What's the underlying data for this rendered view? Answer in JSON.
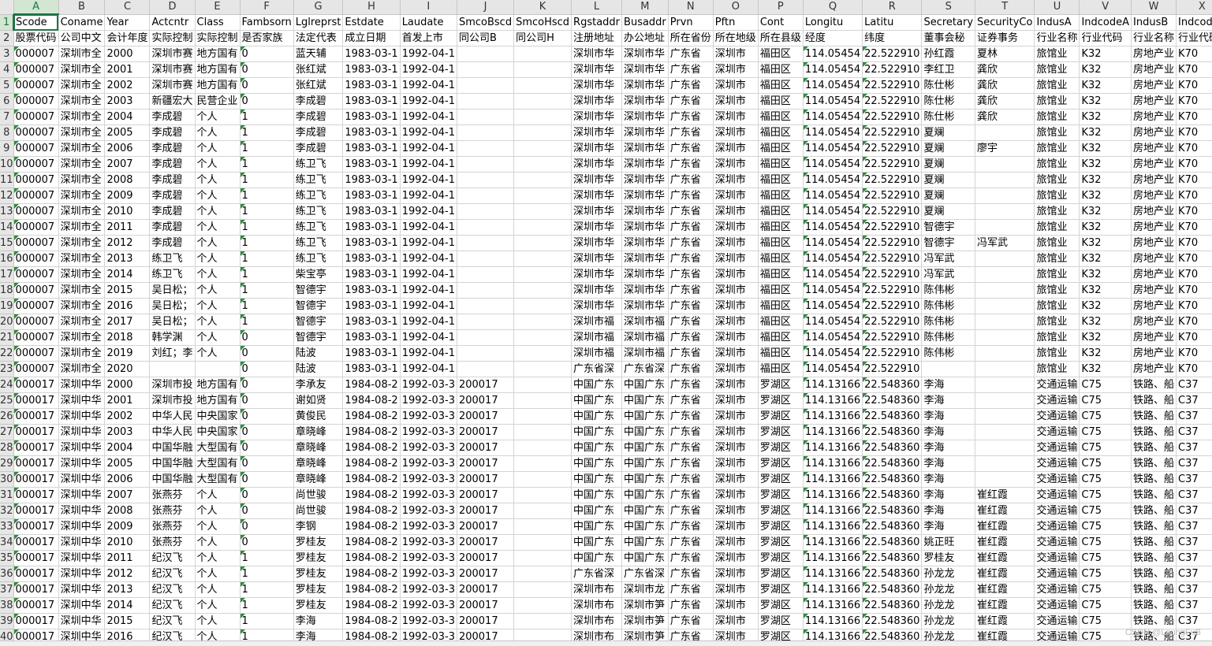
{
  "columns": [
    "A",
    "B",
    "C",
    "D",
    "E",
    "F",
    "G",
    "H",
    "I",
    "J",
    "K",
    "L",
    "M",
    "N",
    "O",
    "P",
    "Q",
    "R",
    "S",
    "T",
    "U",
    "V",
    "W",
    "X"
  ],
  "active_cell": {
    "col": "A",
    "row": 1
  },
  "rows": [
    {
      "n": "1",
      "c": [
        "Scode",
        "Coname",
        "Year",
        "Actcntr",
        "Class",
        "Fambsorn",
        "Lglreprst",
        "Estdate",
        "Laudate",
        "SmcoBscd",
        "SmcoHscd",
        "Rgstaddr",
        "Busaddr",
        "Prvn",
        "Pftn",
        "Cont",
        "Longitu",
        "Latitu",
        "Secretary",
        "SecurityCo",
        "IndusA",
        "IndcodeA",
        "IndusB",
        "IndcodeB"
      ]
    },
    {
      "n": "2",
      "c": [
        "股票代码",
        "公司中文",
        "会计年度",
        "实际控制",
        "实际控制",
        "是否家族",
        "法定代表",
        "成立日期",
        "首发上市",
        "同公司B",
        "同公司H",
        "注册地址",
        "办公地址",
        "所在省份",
        "所在地级",
        "所在县级",
        "经度",
        "纬度",
        "董事会秘",
        "证券事务",
        "行业名称",
        "行业代码",
        "行业名称",
        "行业代码"
      ]
    },
    {
      "n": "3",
      "c": [
        "000007",
        "深圳市全",
        "2000",
        "深圳市赛",
        "地方国有",
        "0",
        "蓝天辅",
        "1983-03-1",
        "1992-04-1",
        "",
        "",
        "深圳市华",
        "深圳市华",
        "广东省",
        "深圳市",
        "福田区",
        "114.05454",
        "22.522910",
        "孙红霞",
        "夏林",
        "旅馆业",
        "K32",
        "房地产业",
        "K70"
      ]
    },
    {
      "n": "4",
      "c": [
        "000007",
        "深圳市全",
        "2001",
        "深圳市赛",
        "地方国有",
        "0",
        "张红斌",
        "1983-03-1",
        "1992-04-1",
        "",
        "",
        "深圳市华",
        "深圳市华",
        "广东省",
        "深圳市",
        "福田区",
        "114.05454",
        "22.522910",
        "李红卫",
        "龚欣",
        "旅馆业",
        "K32",
        "房地产业",
        "K70"
      ]
    },
    {
      "n": "5",
      "c": [
        "000007",
        "深圳市全",
        "2002",
        "深圳市赛",
        "地方国有",
        "0",
        "张红斌",
        "1983-03-1",
        "1992-04-1",
        "",
        "",
        "深圳市华",
        "深圳市华",
        "广东省",
        "深圳市",
        "福田区",
        "114.05454",
        "22.522910",
        "陈仕彬",
        "龚欣",
        "旅馆业",
        "K32",
        "房地产业",
        "K70"
      ]
    },
    {
      "n": "6",
      "c": [
        "000007",
        "深圳市全",
        "2003",
        "新疆宏大",
        "民营企业",
        "0",
        "李成碧",
        "1983-03-1",
        "1992-04-1",
        "",
        "",
        "深圳市华",
        "深圳市华",
        "广东省",
        "深圳市",
        "福田区",
        "114.05454",
        "22.522910",
        "陈仕彬",
        "龚欣",
        "旅馆业",
        "K32",
        "房地产业",
        "K70"
      ]
    },
    {
      "n": "7",
      "c": [
        "000007",
        "深圳市全",
        "2004",
        "李成碧",
        "个人",
        "1",
        "李成碧",
        "1983-03-1",
        "1992-04-1",
        "",
        "",
        "深圳市华",
        "深圳市华",
        "广东省",
        "深圳市",
        "福田区",
        "114.05454",
        "22.522910",
        "陈仕彬",
        "龚欣",
        "旅馆业",
        "K32",
        "房地产业",
        "K70"
      ]
    },
    {
      "n": "8",
      "c": [
        "000007",
        "深圳市全",
        "2005",
        "李成碧",
        "个人",
        "1",
        "李成碧",
        "1983-03-1",
        "1992-04-1",
        "",
        "",
        "深圳市华",
        "深圳市华",
        "广东省",
        "深圳市",
        "福田区",
        "114.05454",
        "22.522910",
        "夏斓",
        "",
        "旅馆业",
        "K32",
        "房地产业",
        "K70"
      ]
    },
    {
      "n": "9",
      "c": [
        "000007",
        "深圳市全",
        "2006",
        "李成碧",
        "个人",
        "1",
        "李成碧",
        "1983-03-1",
        "1992-04-1",
        "",
        "",
        "深圳市华",
        "深圳市华",
        "广东省",
        "深圳市",
        "福田区",
        "114.05454",
        "22.522910",
        "夏斓",
        "廖宇",
        "旅馆业",
        "K32",
        "房地产业",
        "K70"
      ]
    },
    {
      "n": "10",
      "c": [
        "000007",
        "深圳市全",
        "2007",
        "李成碧",
        "个人",
        "1",
        "练卫飞",
        "1983-03-1",
        "1992-04-1",
        "",
        "",
        "深圳市华",
        "深圳市华",
        "广东省",
        "深圳市",
        "福田区",
        "114.05454",
        "22.522910",
        "夏斓",
        "",
        "旅馆业",
        "K32",
        "房地产业",
        "K70"
      ]
    },
    {
      "n": "11",
      "c": [
        "000007",
        "深圳市全",
        "2008",
        "李成碧",
        "个人",
        "1",
        "练卫飞",
        "1983-03-1",
        "1992-04-1",
        "",
        "",
        "深圳市华",
        "深圳市华",
        "广东省",
        "深圳市",
        "福田区",
        "114.05454",
        "22.522910",
        "夏斓",
        "",
        "旅馆业",
        "K32",
        "房地产业",
        "K70"
      ]
    },
    {
      "n": "12",
      "c": [
        "000007",
        "深圳市全",
        "2009",
        "李成碧",
        "个人",
        "1",
        "练卫飞",
        "1983-03-1",
        "1992-04-1",
        "",
        "",
        "深圳市华",
        "深圳市华",
        "广东省",
        "深圳市",
        "福田区",
        "114.05454",
        "22.522910",
        "夏斓",
        "",
        "旅馆业",
        "K32",
        "房地产业",
        "K70"
      ]
    },
    {
      "n": "13",
      "c": [
        "000007",
        "深圳市全",
        "2010",
        "李成碧",
        "个人",
        "1",
        "练卫飞",
        "1983-03-1",
        "1992-04-1",
        "",
        "",
        "深圳市华",
        "深圳市华",
        "广东省",
        "深圳市",
        "福田区",
        "114.05454",
        "22.522910",
        "夏斓",
        "",
        "旅馆业",
        "K32",
        "房地产业",
        "K70"
      ]
    },
    {
      "n": "14",
      "c": [
        "000007",
        "深圳市全",
        "2011",
        "李成碧",
        "个人",
        "1",
        "练卫飞",
        "1983-03-1",
        "1992-04-1",
        "",
        "",
        "深圳市华",
        "深圳市华",
        "广东省",
        "深圳市",
        "福田区",
        "114.05454",
        "22.522910",
        "智德宇",
        "",
        "旅馆业",
        "K32",
        "房地产业",
        "K70"
      ]
    },
    {
      "n": "15",
      "c": [
        "000007",
        "深圳市全",
        "2012",
        "李成碧",
        "个人",
        "1",
        "练卫飞",
        "1983-03-1",
        "1992-04-1",
        "",
        "",
        "深圳市华",
        "深圳市华",
        "广东省",
        "深圳市",
        "福田区",
        "114.05454",
        "22.522910",
        "智德宇",
        "冯军武",
        "旅馆业",
        "K32",
        "房地产业",
        "K70"
      ]
    },
    {
      "n": "16",
      "c": [
        "000007",
        "深圳市全",
        "2013",
        "练卫飞",
        "个人",
        "1",
        "练卫飞",
        "1983-03-1",
        "1992-04-1",
        "",
        "",
        "深圳市华",
        "深圳市华",
        "广东省",
        "深圳市",
        "福田区",
        "114.05454",
        "22.522910",
        "冯军武",
        "",
        "旅馆业",
        "K32",
        "房地产业",
        "K70"
      ]
    },
    {
      "n": "17",
      "c": [
        "000007",
        "深圳市全",
        "2014",
        "练卫飞",
        "个人",
        "1",
        "柴宝亭",
        "1983-03-1",
        "1992-04-1",
        "",
        "",
        "深圳市华",
        "深圳市华",
        "广东省",
        "深圳市",
        "福田区",
        "114.05454",
        "22.522910",
        "冯军武",
        "",
        "旅馆业",
        "K32",
        "房地产业",
        "K70"
      ]
    },
    {
      "n": "18",
      "c": [
        "000007",
        "深圳市全",
        "2015",
        "吴日松；",
        "个人",
        "1",
        "智德宇",
        "1983-03-1",
        "1992-04-1",
        "",
        "",
        "深圳市华",
        "深圳市华",
        "广东省",
        "深圳市",
        "福田区",
        "114.05454",
        "22.522910",
        "陈伟彬",
        "",
        "旅馆业",
        "K32",
        "房地产业",
        "K70"
      ]
    },
    {
      "n": "19",
      "c": [
        "000007",
        "深圳市全",
        "2016",
        "吴日松；",
        "个人",
        "1",
        "智德宇",
        "1983-03-1",
        "1992-04-1",
        "",
        "",
        "深圳市华",
        "深圳市华",
        "广东省",
        "深圳市",
        "福田区",
        "114.05454",
        "22.522910",
        "陈伟彬",
        "",
        "旅馆业",
        "K32",
        "房地产业",
        "K70"
      ]
    },
    {
      "n": "20",
      "c": [
        "000007",
        "深圳市全",
        "2017",
        "吴日松；",
        "个人",
        "1",
        "智德宇",
        "1983-03-1",
        "1992-04-1",
        "",
        "",
        "深圳市福",
        "深圳市福",
        "广东省",
        "深圳市",
        "福田区",
        "114.05454",
        "22.522910",
        "陈伟彬",
        "",
        "旅馆业",
        "K32",
        "房地产业",
        "K70"
      ]
    },
    {
      "n": "21",
      "c": [
        "000007",
        "深圳市全",
        "2018",
        "韩学渊",
        "个人",
        "0",
        "智德宇",
        "1983-03-1",
        "1992-04-1",
        "",
        "",
        "深圳市福",
        "深圳市福",
        "广东省",
        "深圳市",
        "福田区",
        "114.05454",
        "22.522910",
        "陈伟彬",
        "",
        "旅馆业",
        "K32",
        "房地产业",
        "K70"
      ]
    },
    {
      "n": "22",
      "c": [
        "000007",
        "深圳市全",
        "2019",
        "刘红；李",
        "个人",
        "0",
        "陆波",
        "1983-03-1",
        "1992-04-1",
        "",
        "",
        "深圳市福",
        "深圳市福",
        "广东省",
        "深圳市",
        "福田区",
        "114.05454",
        "22.522910",
        "陈伟彬",
        "",
        "旅馆业",
        "K32",
        "房地产业",
        "K70"
      ]
    },
    {
      "n": "23",
      "c": [
        "000007",
        "深圳市全",
        "2020",
        "",
        "",
        "0",
        "陆波",
        "1983-03-1",
        "1992-04-1",
        "",
        "",
        "广东省深",
        "广东省深",
        "广东省",
        "深圳市",
        "福田区",
        "114.05454",
        "22.522910",
        "",
        "",
        "旅馆业",
        "K32",
        "房地产业",
        "K70"
      ]
    },
    {
      "n": "24",
      "c": [
        "000017",
        "深圳中华",
        "2000",
        "深圳市投",
        "地方国有",
        "0",
        "李承友",
        "1984-08-2",
        "1992-03-3",
        "200017",
        "",
        "中国广东",
        "中国广东",
        "广东省",
        "深圳市",
        "罗湖区",
        "114.13166",
        "22.548360",
        "李海",
        "",
        "交通运输",
        "C75",
        "铁路、船",
        "C37"
      ]
    },
    {
      "n": "25",
      "c": [
        "000017",
        "深圳中华",
        "2001",
        "深圳市投",
        "地方国有",
        "0",
        "谢如贤",
        "1984-08-2",
        "1992-03-3",
        "200017",
        "",
        "中国广东",
        "中国广东",
        "广东省",
        "深圳市",
        "罗湖区",
        "114.13166",
        "22.548360",
        "李海",
        "",
        "交通运输",
        "C75",
        "铁路、船",
        "C37"
      ]
    },
    {
      "n": "26",
      "c": [
        "000017",
        "深圳中华",
        "2002",
        "中华人民",
        "中央国家",
        "0",
        "黄俊民",
        "1984-08-2",
        "1992-03-3",
        "200017",
        "",
        "中国广东",
        "中国广东",
        "广东省",
        "深圳市",
        "罗湖区",
        "114.13166",
        "22.548360",
        "李海",
        "",
        "交通运输",
        "C75",
        "铁路、船",
        "C37"
      ]
    },
    {
      "n": "27",
      "c": [
        "000017",
        "深圳中华",
        "2003",
        "中华人民",
        "中央国家",
        "0",
        "章晓峰",
        "1984-08-2",
        "1992-03-3",
        "200017",
        "",
        "中国广东",
        "中国广东",
        "广东省",
        "深圳市",
        "罗湖区",
        "114.13166",
        "22.548360",
        "李海",
        "",
        "交通运输",
        "C75",
        "铁路、船",
        "C37"
      ]
    },
    {
      "n": "28",
      "c": [
        "000017",
        "深圳中华",
        "2004",
        "中国华融",
        "大型国有",
        "0",
        "章晓峰",
        "1984-08-2",
        "1992-03-3",
        "200017",
        "",
        "中国广东",
        "中国广东",
        "广东省",
        "深圳市",
        "罗湖区",
        "114.13166",
        "22.548360",
        "李海",
        "",
        "交通运输",
        "C75",
        "铁路、船",
        "C37"
      ]
    },
    {
      "n": "29",
      "c": [
        "000017",
        "深圳中华",
        "2005",
        "中国华融",
        "大型国有",
        "0",
        "章晓峰",
        "1984-08-2",
        "1992-03-3",
        "200017",
        "",
        "中国广东",
        "中国广东",
        "广东省",
        "深圳市",
        "罗湖区",
        "114.13166",
        "22.548360",
        "李海",
        "",
        "交通运输",
        "C75",
        "铁路、船",
        "C37"
      ]
    },
    {
      "n": "30",
      "c": [
        "000017",
        "深圳中华",
        "2006",
        "中国华融",
        "大型国有",
        "0",
        "章晓峰",
        "1984-08-2",
        "1992-03-3",
        "200017",
        "",
        "中国广东",
        "中国广东",
        "广东省",
        "深圳市",
        "罗湖区",
        "114.13166",
        "22.548360",
        "李海",
        "",
        "交通运输",
        "C75",
        "铁路、船",
        "C37"
      ]
    },
    {
      "n": "31",
      "c": [
        "000017",
        "深圳中华",
        "2007",
        "张燕芬",
        "个人",
        "0",
        "尚世骏",
        "1984-08-2",
        "1992-03-3",
        "200017",
        "",
        "中国广东",
        "中国广东",
        "广东省",
        "深圳市",
        "罗湖区",
        "114.13166",
        "22.548360",
        "李海",
        "崔红霞",
        "交通运输",
        "C75",
        "铁路、船",
        "C37"
      ]
    },
    {
      "n": "32",
      "c": [
        "000017",
        "深圳中华",
        "2008",
        "张燕芬",
        "个人",
        "0",
        "尚世骏",
        "1984-08-2",
        "1992-03-3",
        "200017",
        "",
        "中国广东",
        "中国广东",
        "广东省",
        "深圳市",
        "罗湖区",
        "114.13166",
        "22.548360",
        "李海",
        "崔红霞",
        "交通运输",
        "C75",
        "铁路、船",
        "C37"
      ]
    },
    {
      "n": "33",
      "c": [
        "000017",
        "深圳中华",
        "2009",
        "张燕芬",
        "个人",
        "0",
        "李钢",
        "1984-08-2",
        "1992-03-3",
        "200017",
        "",
        "中国广东",
        "中国广东",
        "广东省",
        "深圳市",
        "罗湖区",
        "114.13166",
        "22.548360",
        "李海",
        "崔红霞",
        "交通运输",
        "C75",
        "铁路、船",
        "C37"
      ]
    },
    {
      "n": "34",
      "c": [
        "000017",
        "深圳中华",
        "2010",
        "张燕芬",
        "个人",
        "0",
        "罗桂友",
        "1984-08-2",
        "1992-03-3",
        "200017",
        "",
        "中国广东",
        "中国广东",
        "广东省",
        "深圳市",
        "罗湖区",
        "114.13166",
        "22.548360",
        "姚正旺",
        "崔红霞",
        "交通运输",
        "C75",
        "铁路、船",
        "C37"
      ]
    },
    {
      "n": "35",
      "c": [
        "000017",
        "深圳中华",
        "2011",
        "纪汉飞",
        "个人",
        "1",
        "罗桂友",
        "1984-08-2",
        "1992-03-3",
        "200017",
        "",
        "中国广东",
        "中国广东",
        "广东省",
        "深圳市",
        "罗湖区",
        "114.13166",
        "22.548360",
        "罗桂友",
        "崔红霞",
        "交通运输",
        "C75",
        "铁路、船",
        "C37"
      ]
    },
    {
      "n": "36",
      "c": [
        "000017",
        "深圳中华",
        "2012",
        "纪汉飞",
        "个人",
        "1",
        "罗桂友",
        "1984-08-2",
        "1992-03-3",
        "200017",
        "",
        "广东省深",
        "广东省深",
        "广东省",
        "深圳市",
        "罗湖区",
        "114.13166",
        "22.548360",
        "孙龙龙",
        "崔红霞",
        "交通运输",
        "C75",
        "铁路、船",
        "C37"
      ]
    },
    {
      "n": "37",
      "c": [
        "000017",
        "深圳中华",
        "2013",
        "纪汉飞",
        "个人",
        "1",
        "罗桂友",
        "1984-08-2",
        "1992-03-3",
        "200017",
        "",
        "深圳市布",
        "深圳市龙",
        "广东省",
        "深圳市",
        "罗湖区",
        "114.13166",
        "22.548360",
        "孙龙龙",
        "崔红霞",
        "交通运输",
        "C75",
        "铁路、船",
        "C37"
      ]
    },
    {
      "n": "38",
      "c": [
        "000017",
        "深圳中华",
        "2014",
        "纪汉飞",
        "个人",
        "1",
        "罗桂友",
        "1984-08-2",
        "1992-03-3",
        "200017",
        "",
        "深圳市布",
        "深圳市笋",
        "广东省",
        "深圳市",
        "罗湖区",
        "114.13166",
        "22.548360",
        "孙龙龙",
        "崔红霞",
        "交通运输",
        "C75",
        "铁路、船",
        "C37"
      ]
    },
    {
      "n": "39",
      "c": [
        "000017",
        "深圳中华",
        "2015",
        "纪汉飞",
        "个人",
        "1",
        "李海",
        "1984-08-2",
        "1992-03-3",
        "200017",
        "",
        "深圳市布",
        "深圳市笋",
        "广东省",
        "深圳市",
        "罗湖区",
        "114.13166",
        "22.548360",
        "孙龙龙",
        "崔红霞",
        "交通运输",
        "C75",
        "铁路、船",
        "C37"
      ]
    },
    {
      "n": "40",
      "c": [
        "000017",
        "深圳中华",
        "2016",
        "纪汉飞",
        "个人",
        "1",
        "李海",
        "1984-08-2",
        "1992-03-3",
        "200017",
        "",
        "深圳市布",
        "深圳市笋",
        "广东省",
        "深圳市",
        "罗湖区",
        "114.13166",
        "22.548360",
        "孙龙龙",
        "崔红霞",
        "交通运输",
        "C75",
        "铁路、船",
        "C37"
      ]
    }
  ],
  "watermark": "CSDN @LeungFuB"
}
